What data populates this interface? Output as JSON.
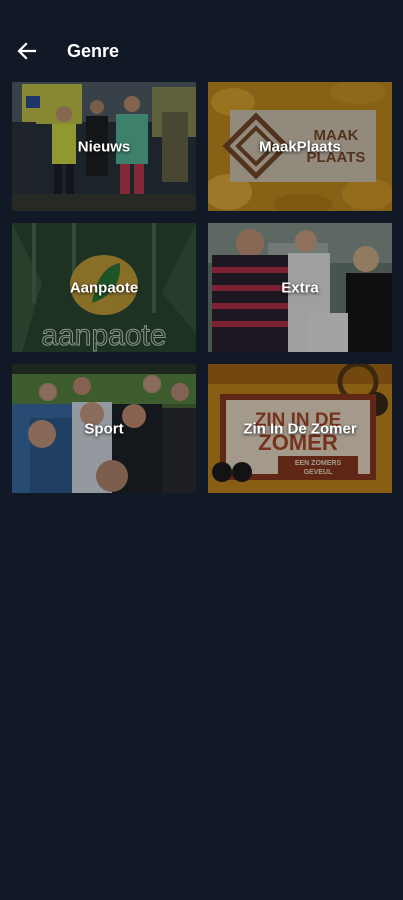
{
  "header": {
    "back_icon": "arrow-left-icon",
    "title": "Genre"
  },
  "genres": [
    {
      "label": "Nieuws"
    },
    {
      "label": "MaakPlaats"
    },
    {
      "label": "Aanpaote"
    },
    {
      "label": "Extra"
    },
    {
      "label": "Sport"
    },
    {
      "label": "Zin In De Zomer"
    }
  ],
  "thumbnail_text": {
    "maakplaats_logo_line1": "MAAK",
    "maakplaats_logo_line2": "PLAATS",
    "aanpaote_logo": "aanpaote",
    "zomer_line1": "ZIN IN DE",
    "zomer_line2": "ZOMER",
    "zomer_sub1": "EEN ZOMERS",
    "zomer_sub2": "GEVEUL"
  },
  "colors": {
    "background": "#111826",
    "text": "#ffffff"
  }
}
